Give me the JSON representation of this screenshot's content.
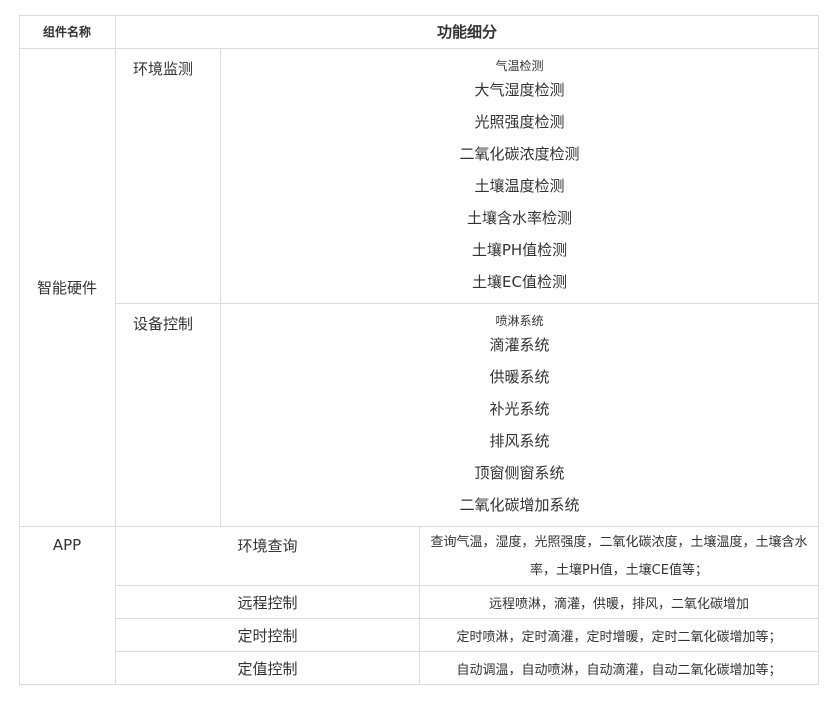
{
  "header": {
    "component_name": "组件名称",
    "function_detail": "功能细分"
  },
  "hardware": {
    "category": "智能硬件",
    "environment": {
      "label": "环境监测",
      "items": [
        "气温检测",
        "大气湿度检测",
        "光照强度检测",
        "二氧化碳浓度检测",
        "土壤温度检测",
        "土壤含水率检测",
        "土壤PH值检测",
        "土壤EC值检测"
      ]
    },
    "device": {
      "label": "设备控制",
      "items": [
        "喷淋系统",
        "滴灌系统",
        "供暖系统",
        "补光系统",
        "排风系统",
        "顶窗侧窗系统",
        "二氧化碳增加系统"
      ]
    }
  },
  "app": {
    "category": "APP",
    "rows": [
      {
        "name": "环境查询",
        "desc": "查询气温，湿度，光照强度，二氧化碳浓度，土壤温度，土壤含水率，土壤PH值，土壤CE值等；"
      },
      {
        "name": "远程控制",
        "desc": "远程喷淋，滴灌，供暖，排风，二氧化碳增加"
      },
      {
        "name": "定时控制",
        "desc": "定时喷淋，定时滴灌，定时增暖，定时二氧化碳增加等；"
      },
      {
        "name": "定值控制",
        "desc": "自动调温，自动喷淋，自动滴灌，自动二氧化碳增加等；"
      }
    ]
  }
}
